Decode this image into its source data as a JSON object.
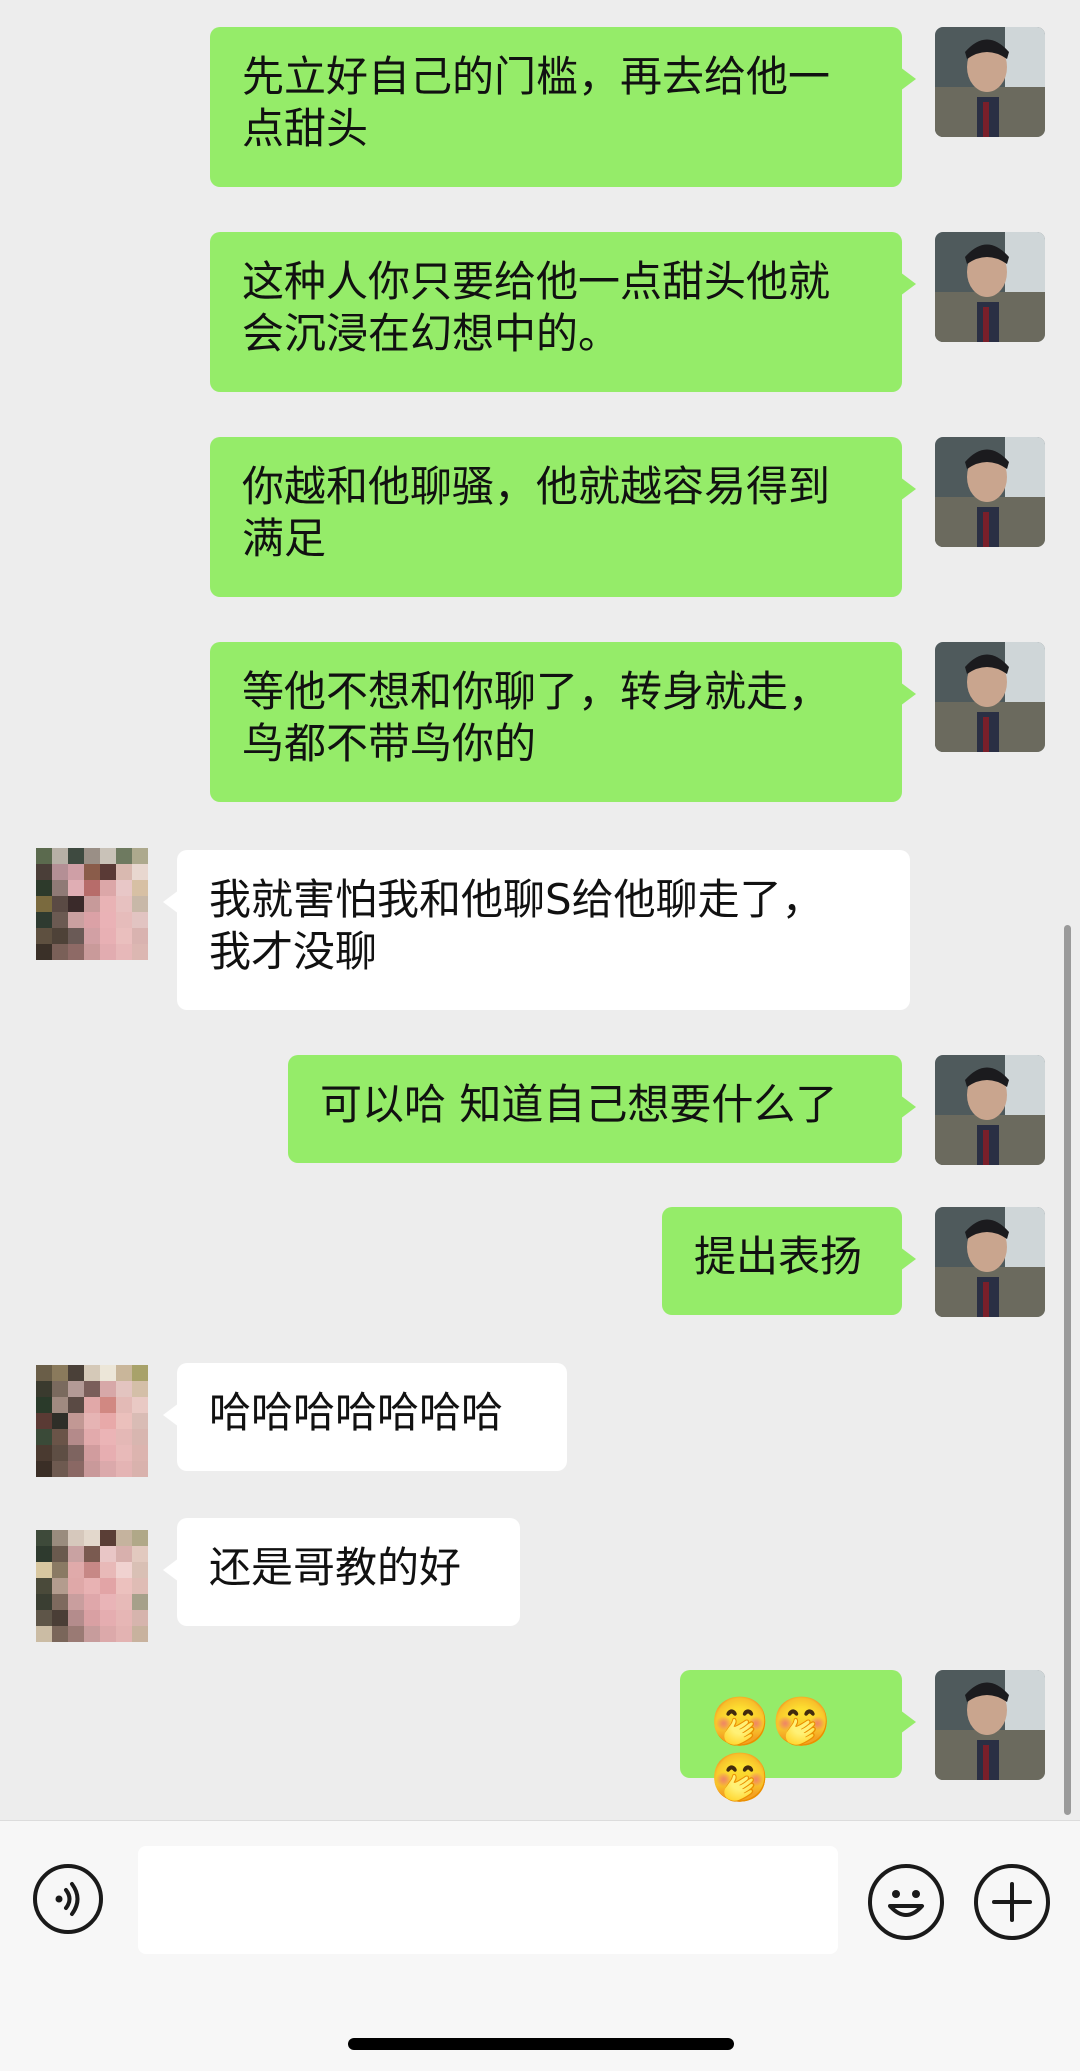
{
  "messages": [
    {
      "side": "out",
      "text": "先立好自己的门槛，再去给他一\n点甜头"
    },
    {
      "side": "out",
      "text": "这种人你只要给他一点甜头他就\n会沉浸在幻想中的。"
    },
    {
      "side": "out",
      "text": "你越和他聊骚，他就越容易得到\n满足"
    },
    {
      "side": "out",
      "text": "等他不想和你聊了，转身就走，\n鸟都不带鸟你的"
    },
    {
      "side": "in",
      "text": "我就害怕我和他聊S给他聊走了，\n我才没聊"
    },
    {
      "side": "out",
      "text": "可以哈 知道自己想要什么了"
    },
    {
      "side": "out",
      "text": "提出表扬"
    },
    {
      "side": "in",
      "text": "哈哈哈哈哈哈哈"
    },
    {
      "side": "in",
      "text": "还是哥教的好"
    },
    {
      "side": "out",
      "text": "🤭🤭🤭"
    }
  ],
  "input": {
    "placeholder": "",
    "voice_icon": "voice-icon",
    "emoji_icon": "emoji-icon",
    "plus_icon": "plus-icon"
  },
  "colors": {
    "outgoing_bubble": "#95ec69",
    "incoming_bubble": "#ffffff",
    "background": "#ededed"
  }
}
